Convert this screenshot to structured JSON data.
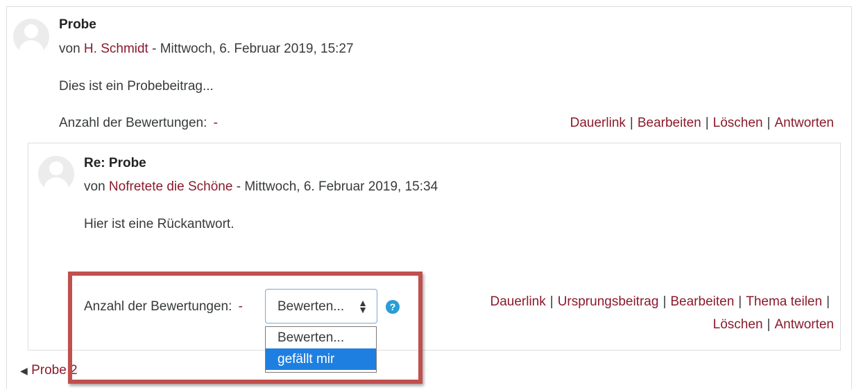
{
  "post": {
    "title": "Probe",
    "by_prefix": "von",
    "author": "H. Schmidt",
    "date": "- Mittwoch, 6. Februar 2019, 15:27",
    "content": "Dies ist ein Probebeitrag...",
    "ratings_label": "Anzahl der Bewertungen:",
    "ratings_value": "-",
    "commands": [
      "Dauerlink",
      "Bearbeiten",
      "Löschen",
      "Antworten"
    ]
  },
  "reply": {
    "title": "Re: Probe",
    "by_prefix": "von",
    "author": "Nofretete die Schöne",
    "date": "- Mittwoch, 6. Februar 2019, 15:34",
    "content": "Hier ist eine Rückantwort.",
    "ratings_label": "Anzahl der Bewertungen:",
    "ratings_value": "-",
    "rating_select_value": "Bewerten...",
    "rating_options": [
      "Bewerten...",
      "gefällt mir"
    ],
    "help_icon": "?",
    "commands_line1": [
      "Dauerlink",
      "Ursprungsbeitrag",
      "Bearbeiten",
      "Thema teilen"
    ],
    "commands_line2": [
      "Löschen",
      "Antworten"
    ]
  },
  "nav": {
    "prev_arrow": "◀",
    "prev_label": "Probe 2"
  },
  "colors": {
    "link": "#8b1a2b",
    "highlight_frame": "#c0504d",
    "selected_option": "#1e7fe0",
    "help_icon": "#2a9dd6"
  }
}
